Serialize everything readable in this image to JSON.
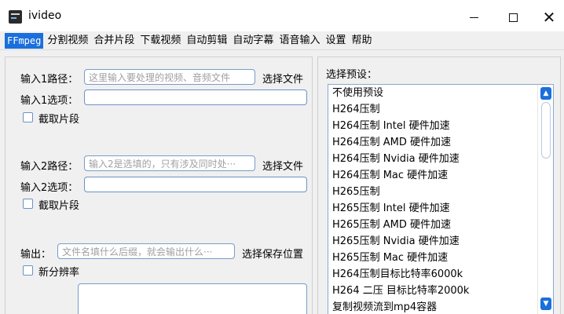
{
  "window": {
    "title": "ivideo",
    "minimize": "—",
    "maximize": "☐",
    "close": "✕"
  },
  "tabs": [
    {
      "label": "FFmpeg",
      "active": true
    },
    {
      "label": "分割视频"
    },
    {
      "label": "合并片段"
    },
    {
      "label": "下载视频"
    },
    {
      "label": "自动剪辑"
    },
    {
      "label": "自动字幕"
    },
    {
      "label": "语音输入"
    },
    {
      "label": "设置"
    },
    {
      "label": "帮助"
    }
  ],
  "input1": {
    "path_label": "输入1路径：",
    "path_placeholder": "这里输入要处理的视频、音频文件",
    "choose_file": "选择文件",
    "options_label": "输入1选项：",
    "clip_label": "截取片段"
  },
  "input2": {
    "path_label": "输入2路径：",
    "path_placeholder": "输入2是选填的，只有涉及同时处···",
    "choose_file": "选择文件",
    "options_label": "输入2选项：",
    "clip_label": "截取片段"
  },
  "output": {
    "label": "输出：",
    "placeholder": "文件名填什么后缀，就会输出什么···",
    "choose_location": "选择保存位置",
    "new_resolution_label": "新分辨率"
  },
  "presets": {
    "title": "选择预设：",
    "items": [
      "不使用预设",
      "H264压制",
      "H264压制 Intel 硬件加速",
      "H264压制 AMD 硬件加速",
      "H264压制 Nvidia 硬件加速",
      "H264压制 Mac 硬件加速",
      "H265压制",
      "H265压制 Intel 硬件加速",
      "H265压制 AMD 硬件加速",
      "H265压制 Nvidia 硬件加速",
      "H265压制 Mac 硬件加速",
      "H264压制目标比特率6000k",
      "H264 二压 目标比特率2000k",
      "复制视频流到mp4容器"
    ]
  },
  "colors": {
    "accent": "#1a6fdc"
  }
}
